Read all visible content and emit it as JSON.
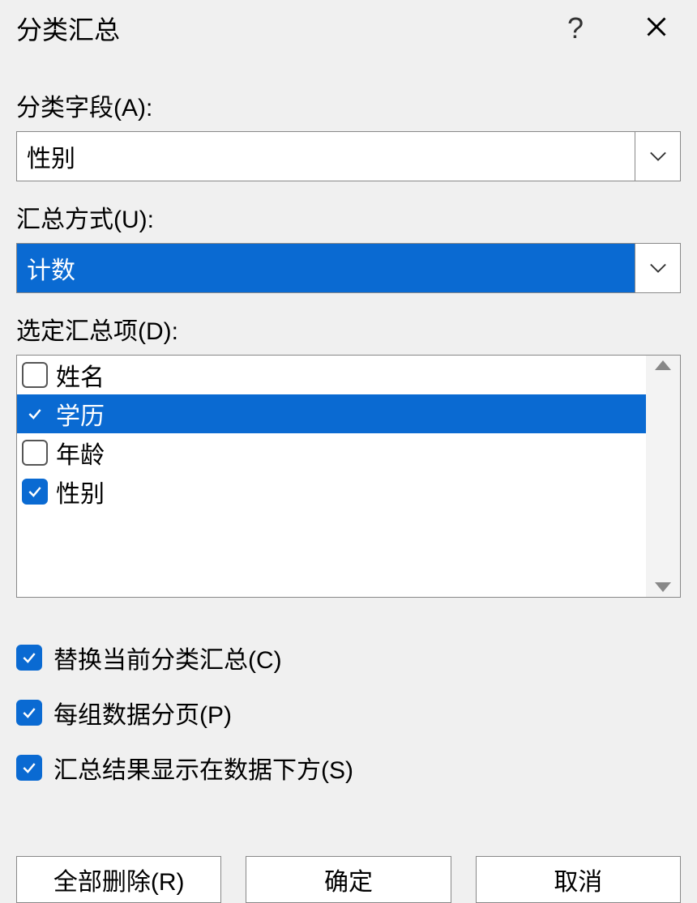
{
  "title": "分类汇总",
  "labels": {
    "category_field": "分类字段(A):",
    "summary_method": "汇总方式(U):",
    "selected_items": "选定汇总项(D):"
  },
  "category_field": {
    "value": "性别"
  },
  "summary_method": {
    "value": "计数"
  },
  "items": [
    {
      "label": "姓名",
      "checked": false,
      "selected": false
    },
    {
      "label": "学历",
      "checked": true,
      "selected": true
    },
    {
      "label": "年龄",
      "checked": false,
      "selected": false
    },
    {
      "label": "性别",
      "checked": true,
      "selected": false
    }
  ],
  "options": [
    {
      "label": "替换当前分类汇总(C)",
      "checked": true
    },
    {
      "label": "每组数据分页(P)",
      "checked": true
    },
    {
      "label": "汇总结果显示在数据下方(S)",
      "checked": true
    }
  ],
  "buttons": {
    "remove_all": "全部删除(R)",
    "ok": "确定",
    "cancel": "取消"
  }
}
